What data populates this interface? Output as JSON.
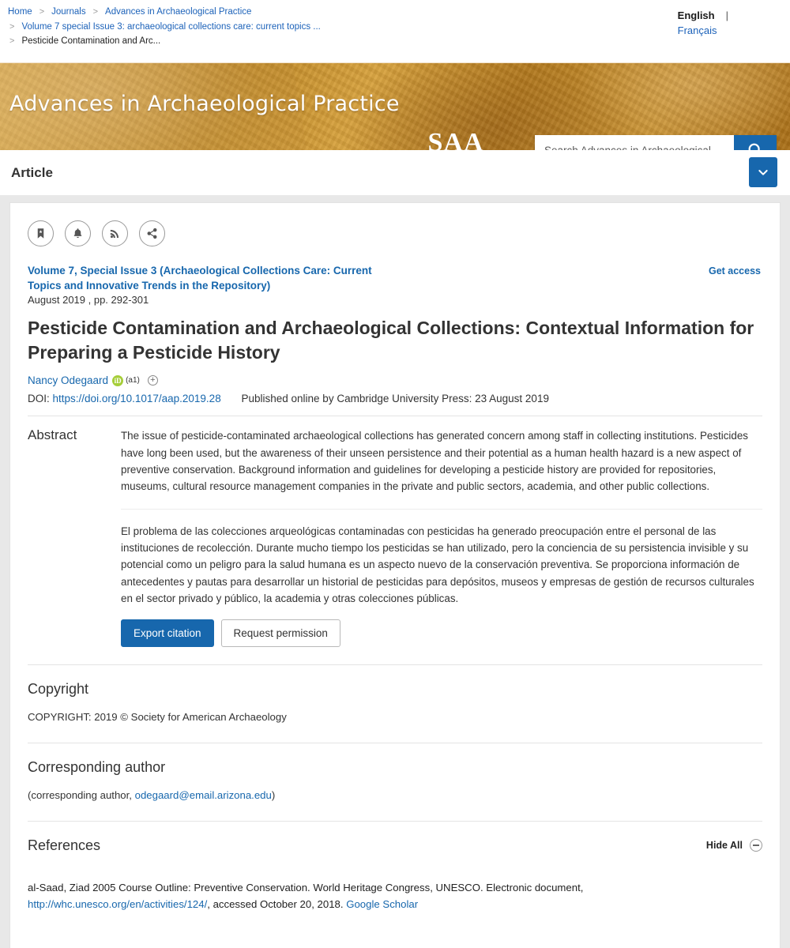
{
  "breadcrumb": {
    "row1": [
      {
        "label": "Home",
        "current": false
      },
      {
        "label": "Journals",
        "current": false
      },
      {
        "label": "Advances in Archaeological Practice",
        "current": false
      }
    ],
    "row2": {
      "label": "Volume 7 special Issue 3: archaeological collections care: current topics ...",
      "current": false
    },
    "row3": {
      "label": "Pesticide Contamination and Arc...",
      "current": true
    },
    "separator": ">"
  },
  "language": {
    "active": "English",
    "divider": "|",
    "alternate": "Français"
  },
  "banner": {
    "journal_title": "Advances in Archaeological Practice",
    "logo_text": "SAA",
    "search_placeholder": "Search Advances in Archaeological",
    "search_value": "",
    "search_icon": "search-icon"
  },
  "article_bar": {
    "type_label": "Article",
    "toggle_icon": "chevron-down-icon"
  },
  "actions": [
    {
      "name": "save-bookmark",
      "icon": "bookmark-icon"
    },
    {
      "name": "alerts",
      "icon": "bell-icon"
    },
    {
      "name": "rss-feed",
      "icon": "rss-icon"
    },
    {
      "name": "share",
      "icon": "share-icon"
    }
  ],
  "issue": {
    "link": "Volume 7, Special Issue 3 (Archaeological Collections Care: Current Topics and Innovative Trends in the Repository)",
    "date_pages": "August 2019 , pp. 292-301",
    "get_access": "Get access"
  },
  "article": {
    "title": "Pesticide Contamination and Archaeological Collections: Contextual Information for Preparing a Pesticide History",
    "author": "Nancy Odegaard",
    "orcid_glyph": "iD",
    "affiliation": "(a1)",
    "expand_authors": "+",
    "doi_label": "DOI:",
    "doi_url": "https://doi.org/10.1017/aap.2019.28",
    "published_online": "Published online by Cambridge University Press: 23 August 2019"
  },
  "abstract": {
    "label": "Abstract",
    "paragraphs": [
      "The issue of pesticide-contaminated archaeological collections has generated concern among staff in collecting institutions. Pesticides have long been used, but the awareness of their unseen persistence and their potential as a human health hazard is a new aspect of preventive conservation. Background information and guidelines for developing a pesticide history are provided for repositories, museums, cultural resource management companies in the private and public sectors, academia, and other public collections.",
      "El problema de las colecciones arqueológicas contaminadas con pesticidas ha generado preocupación entre el personal de las instituciones de recolección. Durante mucho tiempo los pesticidas se han utilizado, pero la conciencia de su persistencia invisible y su potencial como un peligro para la salud humana es un aspecto nuevo de la conservación preventiva. Se proporciona información de antecedentes y pautas para desarrollar un historial de pesticidas para depósitos, museos y empresas de gestión de recursos culturales en el sector privado y público, la academia y otras colecciones públicas."
    ]
  },
  "buttons": {
    "export_citation": "Export citation",
    "request_permission": "Request permission"
  },
  "copyright": {
    "heading": "Copyright",
    "text": "COPYRIGHT: 2019 © Society for American Archaeology"
  },
  "corresponding_author": {
    "heading": "Corresponding author",
    "prefix": "(corresponding author, ",
    "email": "odegaard@email.arizona.edu",
    "suffix": ")"
  },
  "references": {
    "heading": "References",
    "hide_all": "Hide All",
    "hide_all_icon": "minus-circle-icon",
    "items": [
      {
        "text": "al-Saad, Ziad 2005 Course Outline: Preventive Conservation. World Heritage Congress, UNESCO. Electronic document,",
        "url": "http://whc.unesco.org/en/activities/124/",
        "accessed": ", accessed October 20, 2018.",
        "scholar": "Google Scholar"
      }
    ]
  }
}
